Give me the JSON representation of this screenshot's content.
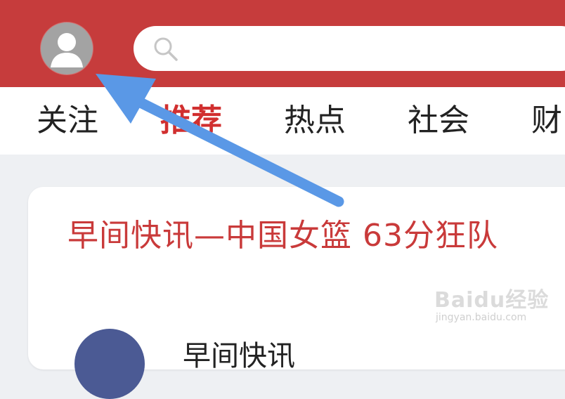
{
  "header": {
    "search": {
      "placeholder": ""
    }
  },
  "tabs": [
    {
      "label": "关注",
      "active": false
    },
    {
      "label": "推荐",
      "active": true
    },
    {
      "label": "热点",
      "active": false
    },
    {
      "label": "社会",
      "active": false
    },
    {
      "label": "财",
      "active": false
    }
  ],
  "feed": {
    "items": [
      {
        "headline": "早间快讯—中国女篮 63分狂队",
        "source": "早间快讯"
      }
    ]
  },
  "watermark": {
    "logo": "Baidu经验",
    "url": "jingyan.baidu.com"
  },
  "colors": {
    "header_bg": "#c63c3c",
    "active_tab": "#d12f2f",
    "headline": "#c93a3a",
    "annotation_arrow": "#5a98e6"
  },
  "icons": {
    "avatar": "user-avatar-icon",
    "search": "search-icon"
  }
}
